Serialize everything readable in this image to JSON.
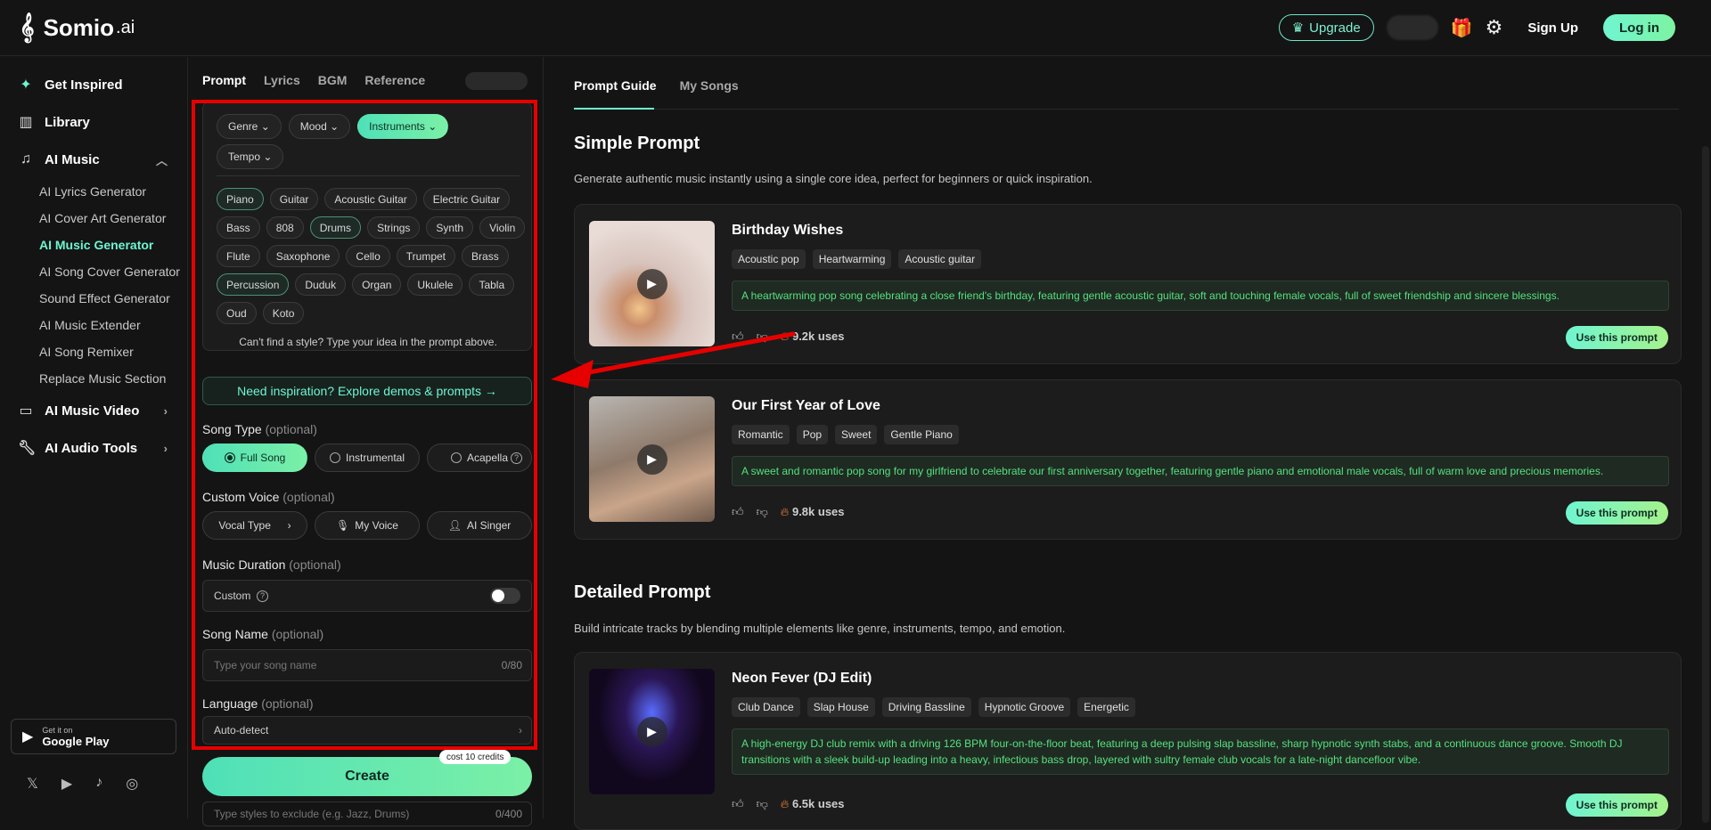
{
  "brand": {
    "name": "Somio",
    "tld": ".ai"
  },
  "topbar": {
    "upgrade": "Upgrade",
    "signup": "Sign Up",
    "login": "Log in"
  },
  "sidebar": {
    "items": [
      {
        "label": "Get Inspired",
        "icon": "sparkle-icon"
      },
      {
        "label": "Library",
        "icon": "library-icon"
      },
      {
        "label": "AI Music",
        "icon": "music-note-icon"
      }
    ],
    "sub": [
      "AI Lyrics Generator",
      "AI Cover Art Generator",
      "AI Music Generator",
      "AI Song Cover Generator",
      "Sound Effect Generator",
      "AI Music Extender",
      "AI Song Remixer",
      "Replace Music Section"
    ],
    "more": [
      {
        "label": "AI Music Video",
        "icon": "video-icon"
      },
      {
        "label": "AI Audio Tools",
        "icon": "wrench-icon"
      }
    ],
    "gplay": {
      "small": "Get it on",
      "big": "Google Play"
    }
  },
  "panel": {
    "tabs": [
      "Prompt",
      "Lyrics",
      "BGM",
      "Reference"
    ],
    "filters": [
      "Genre",
      "Mood",
      "Instruments",
      "Tempo"
    ],
    "instruments": [
      "Piano",
      "Guitar",
      "Acoustic Guitar",
      "Electric Guitar",
      "Bass",
      "808",
      "Drums",
      "Strings",
      "Synth",
      "Violin",
      "Flute",
      "Saxophone",
      "Cello",
      "Trumpet",
      "Brass",
      "Percussion",
      "Duduk",
      "Organ",
      "Ukulele",
      "Tabla",
      "Oud",
      "Koto"
    ],
    "cant_find": "Can't find a style? Type your idea in the prompt above.",
    "inspire": "Need inspiration? Explore demos & prompts →",
    "song_type": {
      "label": "Song Type",
      "opt": "(optional)",
      "options": [
        "Full Song",
        "Instrumental",
        "Acapella"
      ]
    },
    "custom_voice": {
      "label": "Custom Voice",
      "opt": "(optional)",
      "options": [
        "Vocal Type",
        "My Voice",
        "AI Singer"
      ]
    },
    "duration": {
      "label": "Music Duration",
      "opt": "(optional)",
      "custom": "Custom"
    },
    "song_name": {
      "label": "Song Name",
      "opt": "(optional)",
      "placeholder": "Type your song name",
      "counter": "0/80"
    },
    "language": {
      "label": "Language",
      "opt": "(optional)",
      "value": "Auto-detect"
    },
    "cost": "cost 10 credits",
    "create": "Create",
    "exclude": {
      "placeholder": "Type styles to exclude (e.g. Jazz, Drums)",
      "counter": "0/400"
    }
  },
  "main": {
    "tabs": [
      "Prompt Guide",
      "My Songs"
    ],
    "simple": {
      "title": "Simple Prompt",
      "desc": "Generate authentic music instantly using a single core idea, perfect for beginners or quick inspiration."
    },
    "detailed": {
      "title": "Detailed Prompt",
      "desc": "Build intricate tracks by blending multiple elements like genre, instruments, tempo, and emotion."
    },
    "use_btn": "Use this prompt",
    "cards": [
      {
        "title": "Birthday Wishes",
        "tags": [
          "Acoustic pop",
          "Heartwarming",
          "Acoustic guitar"
        ],
        "prompt": "A heartwarming pop song celebrating a close friend's birthday, featuring gentle acoustic guitar, soft and touching female vocals, full of sweet friendship and sincere blessings.",
        "uses": "9.2k uses"
      },
      {
        "title": "Our First Year of Love",
        "tags": [
          "Romantic",
          "Pop",
          "Sweet",
          "Gentle Piano"
        ],
        "prompt": "A sweet and romantic pop song for my girlfriend to celebrate our first anniversary together, featuring gentle piano and emotional male vocals, full of warm love and precious memories.",
        "uses": "9.8k uses"
      },
      {
        "title": "Neon Fever (DJ Edit)",
        "tags": [
          "Club Dance",
          "Slap House",
          "Driving Bassline",
          "Hypnotic Groove",
          "Energetic"
        ],
        "prompt": "A high-energy DJ club remix with a driving 126 BPM four-on-the-floor beat, featuring a deep pulsing slap bassline, sharp hypnotic synth stabs, and a continuous dance groove. Smooth DJ transitions with a sleek build-up leading into a heavy, infectious bass drop, layered with sultry female club vocals for a late-night dancefloor vibe.",
        "uses": "6.5k uses"
      }
    ]
  },
  "colors": {
    "accent": "#6ff5d1",
    "highlight": "#e60000",
    "prompt_text": "#55e07f"
  }
}
